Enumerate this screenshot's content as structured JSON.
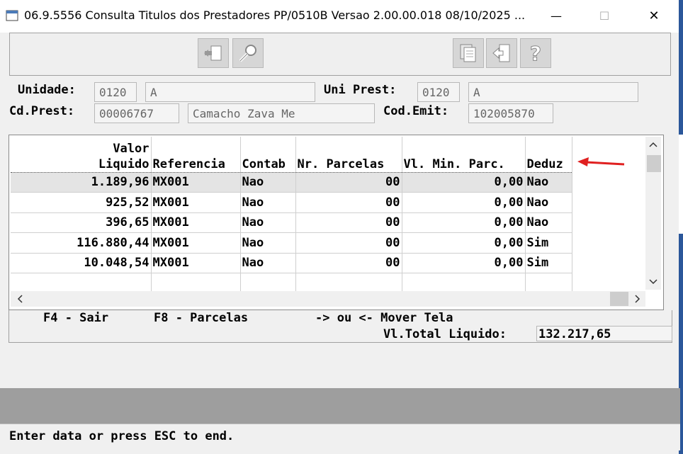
{
  "window": {
    "title": "06.9.5556   Consulta  Titulos dos Prestadores PP/0510B Versao 2.00.00.018 08/10/2025 ...",
    "minimize": "—",
    "maximize": "☐",
    "close": "✕"
  },
  "toolbar": {
    "icons": [
      "exit-door-icon",
      "key-icon",
      "copy-pages-icon",
      "exit-icon",
      "help-icon"
    ]
  },
  "form": {
    "unidade_label": "Unidade:",
    "unidade_code": "0120",
    "unidade_name": "A",
    "uni_prest_label": "Uni Prest:",
    "uni_prest_code": "0120",
    "uni_prest_name": "A",
    "cd_prest_label": "Cd.Prest:",
    "cd_prest_code": "00006767",
    "cd_prest_name": "Camacho Zava Me",
    "cod_emit_label": "Cod.Emit:",
    "cod_emit_value": "102005870"
  },
  "grid": {
    "headers": {
      "valor_line1": "Valor",
      "valor_line2": "Liquido",
      "referencia": "Referencia",
      "contab": "Contab",
      "nr_parcelas": "Nr. Parcelas",
      "vl_min_parc": "Vl. Min. Parc.",
      "deduz": "Deduz"
    },
    "rows": [
      {
        "valor": "1.189,96",
        "referencia": "MX001",
        "contab": "Nao",
        "nr_parcelas": "00",
        "vl_min": "0,00",
        "deduz": "Nao"
      },
      {
        "valor": "925,52",
        "referencia": "MX001",
        "contab": "Nao",
        "nr_parcelas": "00",
        "vl_min": "0,00",
        "deduz": "Nao"
      },
      {
        "valor": "396,65",
        "referencia": "MX001",
        "contab": "Nao",
        "nr_parcelas": "00",
        "vl_min": "0,00",
        "deduz": "Nao"
      },
      {
        "valor": "116.880,44",
        "referencia": "MX001",
        "contab": "Nao",
        "nr_parcelas": "00",
        "vl_min": "0,00",
        "deduz": "Sim"
      },
      {
        "valor": "10.048,54",
        "referencia": "MX001",
        "contab": "Nao",
        "nr_parcelas": "00",
        "vl_min": "0,00",
        "deduz": "Sim"
      }
    ]
  },
  "footer": {
    "f4": "F4 - Sair",
    "f8": "F8 - Parcelas",
    "mover": "-> ou <- Mover Tela",
    "total_label": "Vl.Total Liquido:",
    "total_value": "132.217,65"
  },
  "statusbar": {
    "message": "Enter data or press ESC to end."
  },
  "colors": {
    "arrow": "#e02020",
    "selected_row": "#e4e4e4"
  }
}
